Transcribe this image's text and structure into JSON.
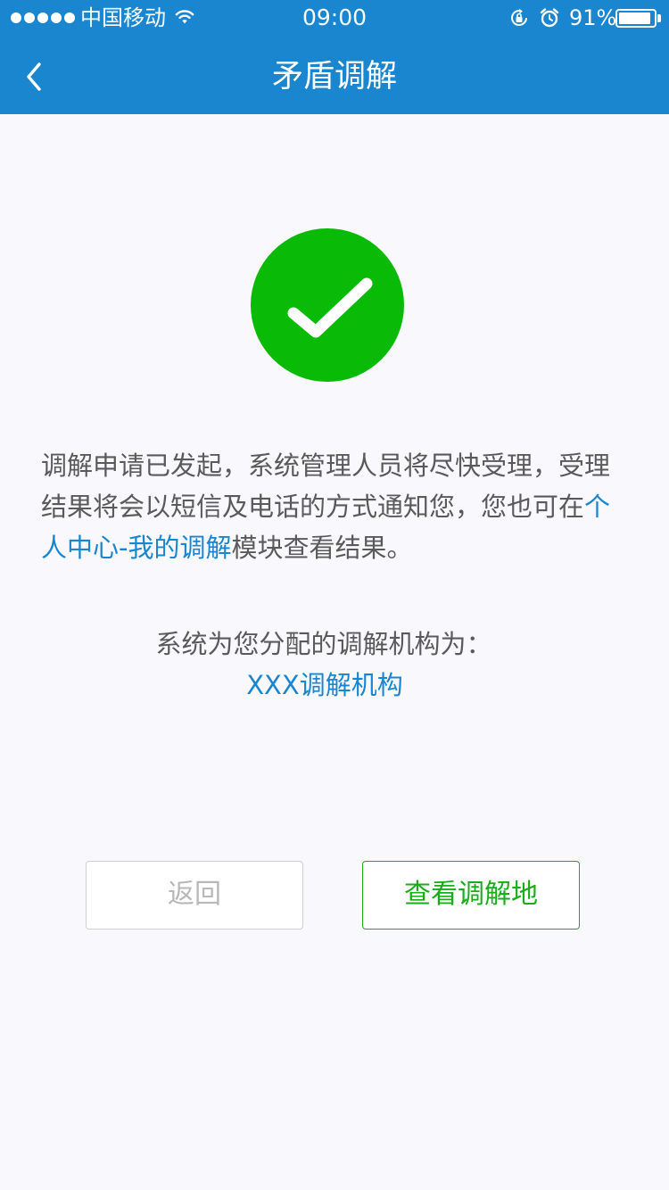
{
  "status_bar": {
    "carrier": "中国移动",
    "time": "09:00",
    "battery_percent": "91%",
    "battery_level": 0.91,
    "icons": [
      "signal-dots-icon",
      "wifi-icon",
      "rotation-lock-icon",
      "alarm-icon",
      "battery-icon"
    ]
  },
  "nav": {
    "title": "矛盾调解",
    "back_icon": "chevron-left-icon"
  },
  "success": {
    "icon": "check-circle-icon",
    "color": "#09bb07"
  },
  "message": {
    "part1": "调解申请已发起，系统管理人员将尽快受理，受理结果将会以短信及电话的方式通知您，您也可在",
    "link": "个人中心-我的调解",
    "part2": "模块查看结果。"
  },
  "organization": {
    "label": "系统为您分配的调解机构为：",
    "name": "XXX调解机构"
  },
  "buttons": {
    "back_label": "返回",
    "view_label": "查看调解地"
  },
  "colors": {
    "header": "#1a86cf",
    "link": "#1a86cf",
    "success": "#09bb07",
    "primary_button": "#1aad19",
    "background": "#f9f8fc"
  }
}
